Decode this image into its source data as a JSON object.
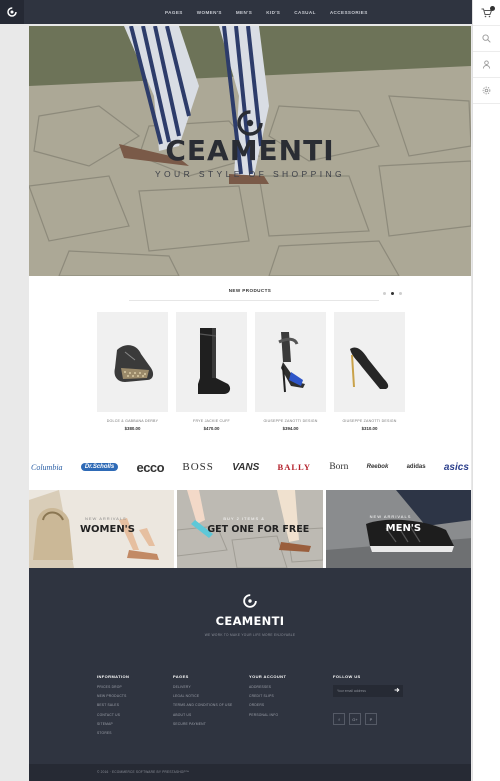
{
  "nav": {
    "items": [
      "PAGES",
      "WOMEN'S",
      "MEN'S",
      "KID'S",
      "CASUAL",
      "ACCESSORIES"
    ]
  },
  "rail": {
    "icons": [
      "cart-icon",
      "search-icon",
      "user-icon",
      "settings-icon"
    ]
  },
  "hero": {
    "title": "CEAMENTI",
    "subtitle": "YOUR STYLE OF SHOPPING"
  },
  "new_products": {
    "title": "NEW PRODUCTS",
    "items": [
      {
        "name": "DOLCE & GABBANA DERBY",
        "price": "$380.00"
      },
      {
        "name": "FRYE JACKIE CUFF",
        "price": "$470.00"
      },
      {
        "name": "GIUSEPPE ZANOTTI DESIGN",
        "price": "$394.00"
      },
      {
        "name": "GIUSEPPE ZANOTTI DESIGN",
        "price": "$310.00"
      }
    ]
  },
  "brands": [
    "Columbia",
    "Dr.Scholls",
    "ecco",
    "BOSS",
    "VANS",
    "BALLY",
    "Born",
    "Reebok",
    "adidas",
    "asics"
  ],
  "banners": [
    {
      "pre": "NEW ARRIVALS",
      "title": "WOMEN'S"
    },
    {
      "pre": "BUY 2 ITEMS &",
      "title": "GET ONE FOR FREE"
    },
    {
      "pre": "NEW ARRIVALS",
      "title": "MEN'S"
    }
  ],
  "footer": {
    "title": "CEAMENTI",
    "tagline": "WE WORK TO MAKE YOUR LIFE MORE ENJOYABLE",
    "columns": [
      {
        "heading": "INFORMATION",
        "links": [
          "PRICES DROP",
          "NEW PRODUCTS",
          "BEST SALES",
          "CONTACT US",
          "SITEMAP",
          "STORES"
        ]
      },
      {
        "heading": "PAGES",
        "links": [
          "DELIVERY",
          "LEGAL NOTICE",
          "TERMS AND CONDITIONS OF USE",
          "ABOUT US",
          "SECURE PAYMENT"
        ]
      },
      {
        "heading": "YOUR ACCOUNT",
        "links": [
          "ADDRESSES",
          "CREDIT SLIPS",
          "ORDERS",
          "PERSONAL INFO"
        ]
      }
    ],
    "follow": {
      "heading": "FOLLOW US",
      "placeholder": "Your email address",
      "social": [
        "f",
        "G+",
        "P"
      ]
    },
    "copyright": "© 2016 · ECOMMERCE SOFTWARE BY PRESTASHOP™"
  }
}
